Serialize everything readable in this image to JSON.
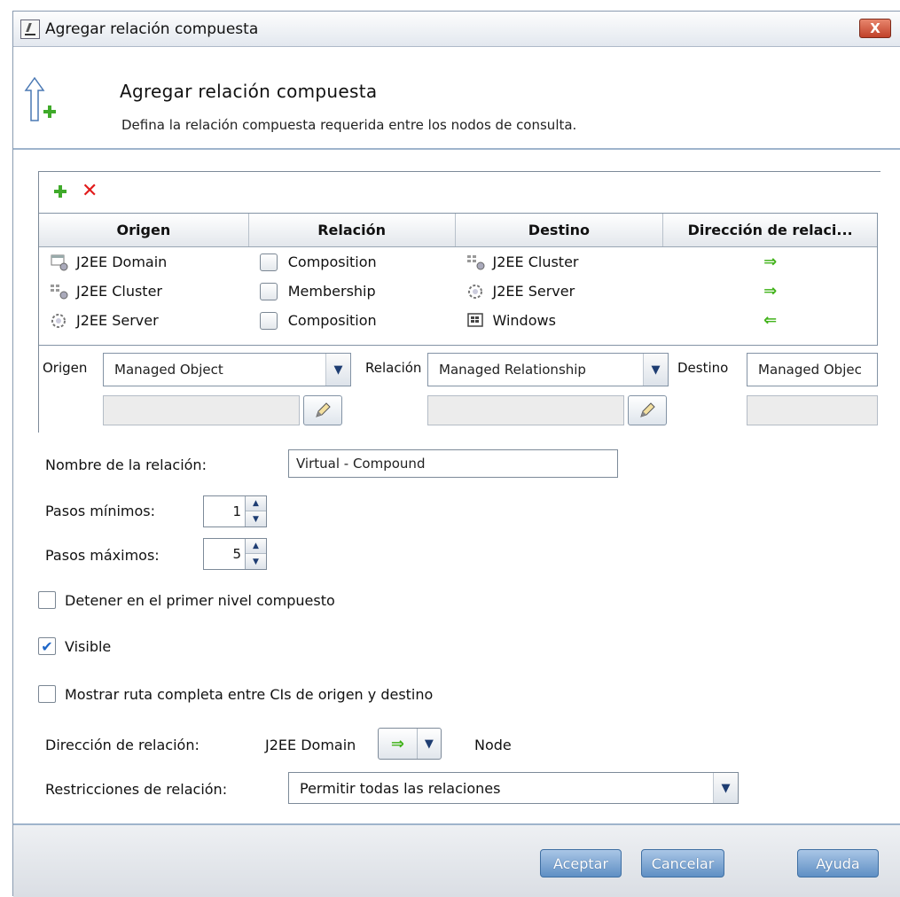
{
  "window": {
    "title": "Agregar relación compuesta",
    "close_label": "X"
  },
  "header": {
    "title": "Agregar relación compuesta",
    "description": "Defina la relación compuesta requerida entre los nodos de consulta."
  },
  "toolbar": {
    "add_icon": "add-icon",
    "delete_icon": "delete-icon"
  },
  "table": {
    "columns": [
      "Origen",
      "Relación",
      "Destino",
      "Dirección de relaci..."
    ],
    "rows": [
      {
        "origin": "J2EE Domain",
        "origin_icon": "domain-icon",
        "relation": "Composition",
        "target": "J2EE Cluster",
        "target_icon": "cluster-icon",
        "direction": "⇒"
      },
      {
        "origin": "J2EE Cluster",
        "origin_icon": "cluster-icon",
        "relation": "Membership",
        "target": "J2EE Server",
        "target_icon": "server-icon",
        "direction": "⇒"
      },
      {
        "origin": "J2EE Server",
        "origin_icon": "server-icon",
        "relation": "Composition",
        "target": "Windows",
        "target_icon": "windows-icon",
        "direction": "⇐"
      }
    ]
  },
  "filters": {
    "origin_label": "Origen",
    "origin_value": "Managed Object",
    "relation_label": "Relación",
    "relation_value": "Managed Relationship",
    "target_label": "Destino",
    "target_value": "Managed Objec"
  },
  "form": {
    "name_label": "Nombre de la relación:",
    "name_value": "Virtual - Compound",
    "min_steps_label": "Pasos mínimos:",
    "min_steps_value": "1",
    "max_steps_label": "Pasos máximos:",
    "max_steps_value": "5",
    "stop_first_label": "Detener en el primer nivel compuesto",
    "stop_first_checked": false,
    "visible_label": "Visible",
    "visible_checked": true,
    "show_path_label": "Mostrar ruta completa entre CIs de origen y destino",
    "show_path_checked": false,
    "direction_label": "Dirección de relación:",
    "direction_from": "J2EE Domain",
    "direction_arrow": "⇒",
    "direction_to": "Node",
    "restrictions_label": "Restricciones de relación:",
    "restrictions_value": "Permitir todas las relaciones"
  },
  "buttons": {
    "ok": "Aceptar",
    "cancel": "Cancelar",
    "help": "Ayuda"
  },
  "colors": {
    "accent_arrow": "#43b31c",
    "button_blue": "#5f8fc4",
    "close_red": "#c0412a",
    "separator": "#9fb4cc"
  }
}
